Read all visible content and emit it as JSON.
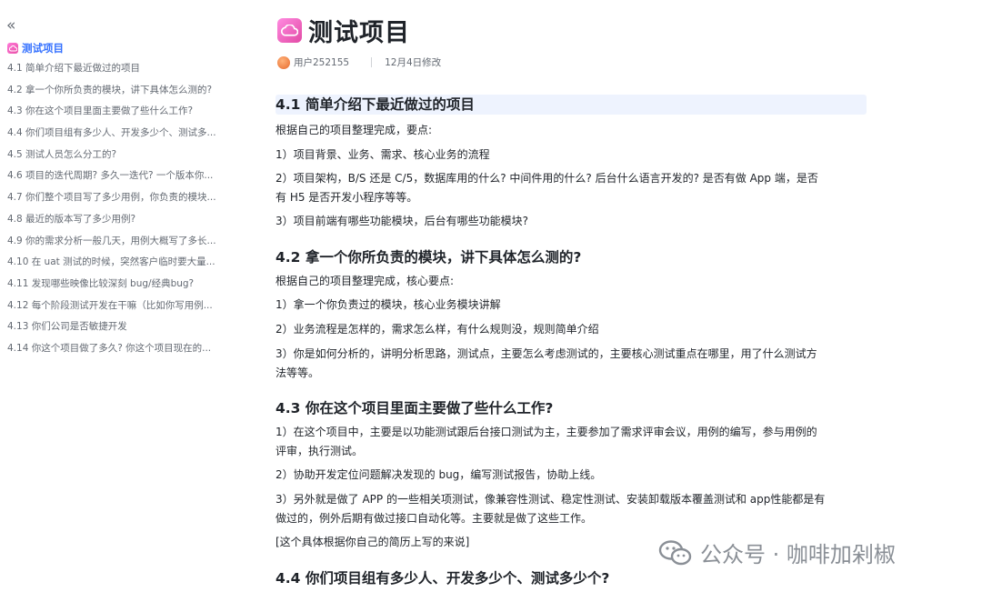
{
  "sidebar": {
    "collapse_glyph": "«",
    "title": "测试项目",
    "items": [
      "4.1 简单介绍下最近做过的项目",
      "4.2 拿一个你所负责的模块，讲下具体怎么测的?",
      "4.3 你在这个项目里面主要做了些什么工作?",
      "4.4 你们项目组有多少人、开发多少个、测试多...",
      "4.5 测试人员怎么分工的?",
      "4.6 项目的迭代周期? 多久一迭代? 一个版本你...",
      "4.7 你们整个项目写了多少用例，你负责的模块...",
      "4.8 最近的版本写了多少用例?",
      "4.9 你的需求分析一般几天，用例大概写了多长...",
      "4.10 在 uat 测试的时候，突然客户临时要大量...",
      "4.11 发现哪些映像比较深刻 bug/经典bug?",
      "4.12 每个阶段测试开发在干嘛（比如你写用例...",
      "4.13 你们公司是否敏捷开发",
      "4.14 你这个项目做了多久? 你这个项目现在的..."
    ]
  },
  "doc": {
    "title": "测试项目",
    "author": "用户252155",
    "modified": "12月4日修改",
    "sections": {
      "s1": {
        "heading": "4.1 简单介绍下最近做过的项目",
        "p1": "根据自己的项目整理完成，要点:",
        "p2": "1）项目背景、业务、需求、核心业务的流程",
        "p3a": "2）项目架构，B/S 还是 C/5，数据库用的什么? 中间件用的什么? 后台什么语言开发的? 是否有做 App 端，是否",
        "p3b": "有 H5 是否开发小程序等等。",
        "p4": "3）项目前端有哪些功能模块，后台有哪些功能模块?"
      },
      "s2": {
        "heading": "4.2 拿一个你所负责的模块，讲下具体怎么测的?",
        "p1": "根据自己的项目整理完成，核心要点:",
        "p2": "1）拿一个你负责过的模块，核心业务模块讲解",
        "p3": "2）业务流程是怎样的，需求怎么样，有什么规则没，规则简单介绍",
        "p4a": "3）你是如何分析的，讲明分析思路，测试点，主要怎么考虑测试的，主要核心测试重点在哪里，用了什么测试方",
        "p4b": "法等等。"
      },
      "s3": {
        "heading": "4.3 你在这个项目里面主要做了些什么工作?",
        "p1a": "1）在这个项目中，主要是以功能测试跟后台接口测试为主，主要参加了需求评审会议，用例的编写，参与用例的",
        "p1b": "评审，执行测试。",
        "p2": "2）协助开发定位问题解决发现的 bug，编写测试报告，协助上线。",
        "p3a": "3）另外就是做了 APP 的一些相关项测试，像兼容性测试、稳定性测试、安装卸载版本覆盖测试和 app性能都是有",
        "p3b": "做过的，例外后期有做过接口自动化等。主要就是做了这些工作。",
        "p4": "[这个具体根据你自己的简历上写的来说]"
      },
      "s4": {
        "heading": "4.4 你们项目组有多少人、开发多少个、测试多少个?"
      }
    }
  },
  "watermark": {
    "text": "公众号 · 咖啡加剁椒"
  },
  "colors": {
    "accent": "#3370ff",
    "doc_icon": "#e84fa6",
    "heading_highlight": "#eef3fe"
  }
}
